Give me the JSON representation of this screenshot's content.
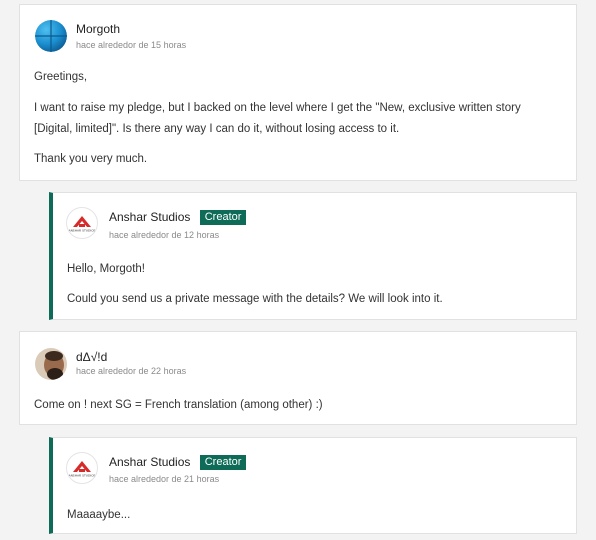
{
  "comments": [
    {
      "author": "Morgoth",
      "time": "hace alrededor de 15 horas",
      "paragraphs": [
        "Greetings,",
        "I want to raise my pledge, but I backed on the level where I get the \"New, exclusive written story",
        "[Digital, limited]\". Is there any way I can do it, without losing access to it.",
        "Thank you very much."
      ],
      "reply": {
        "author": "Anshar Studios",
        "badge": "Creator",
        "time": "hace alrededor de 12 horas",
        "paragraphs": [
          "Hello, Morgoth!",
          "Could you send us a private message with the details? We will look into it."
        ]
      }
    },
    {
      "author": "dΔ√!d",
      "time": "hace alrededor de 22 horas",
      "paragraphs": [
        "Come on ! next SG = French translation (among other) :)"
      ],
      "reply": {
        "author": "Anshar Studios",
        "badge": "Creator",
        "time": "hace alrededor de 21 horas",
        "paragraphs": [
          "Maaaaybe..."
        ]
      }
    }
  ],
  "logo_text": "ANSHAR STUDIOS",
  "colors": {
    "creator_accent": "#0e6b58",
    "logo_red": "#d62b2b",
    "morgoth_avatar": "#1b8fd0"
  }
}
